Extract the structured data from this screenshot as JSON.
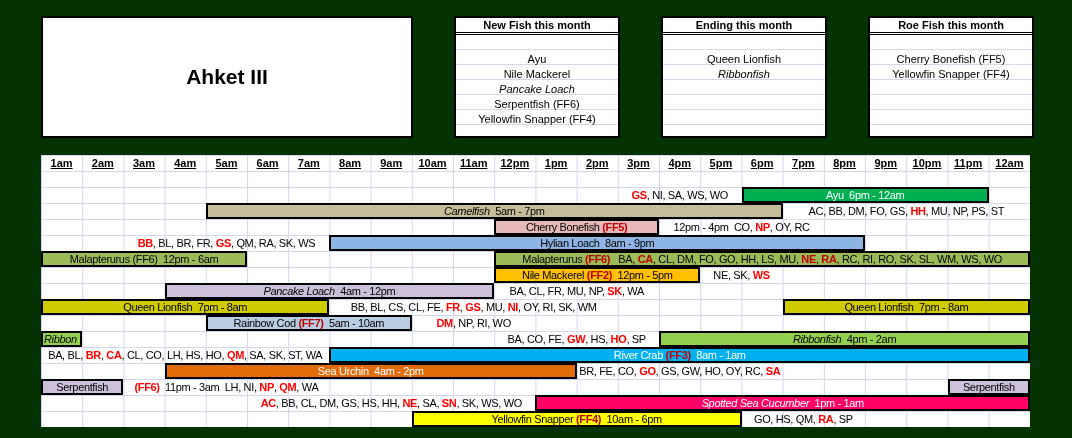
{
  "title": "Ahket III",
  "lists": [
    {
      "heading": "New Fish this month",
      "items": [
        {
          "text": "Ayu",
          "italic": false
        },
        {
          "text": "Nile Mackerel",
          "italic": false
        },
        {
          "text": "Pancake Loach",
          "italic": true
        },
        {
          "text": "Serpentfish (FF6)",
          "italic": false
        },
        {
          "text": "Yellowfin Snapper (FF4)",
          "italic": false
        }
      ]
    },
    {
      "heading": "Ending this month",
      "items": [
        {
          "text": "Queen Lionfish",
          "italic": false
        },
        {
          "text": "Ribbonfish",
          "italic": true
        }
      ]
    },
    {
      "heading": "Roe Fish this month",
      "items": [
        {
          "text": "Cherry Bonefish (FF5)",
          "italic": false
        },
        {
          "text": "Yellowfin Snapper (FF4)",
          "italic": false
        }
      ]
    }
  ],
  "hours": [
    "1am",
    "2am",
    "3am",
    "4am",
    "5am",
    "6am",
    "7am",
    "8am",
    "9am",
    "10am",
    "11am",
    "12pm",
    "1pm",
    "2pm",
    "3pm",
    "4pm",
    "5pm",
    "6pm",
    "7pm",
    "8pm",
    "9pm",
    "10pm",
    "11pm",
    "12am"
  ],
  "rows": [
    {
      "segments": [
        {
          "kind": "note",
          "text": "**GS**, NI, SA, WS, WO"
        },
        {
          "kind": "bar",
          "text": "Ayu  6pm - 12am",
          "color": "#00b050"
        }
      ]
    },
    {
      "segments": [
        {
          "kind": "bar",
          "text": "*Camelfish*  5am - 7pm",
          "color": "#c4bd97"
        },
        {
          "kind": "note",
          "text": "AC, BB, DM, FO, GS, **HH**, MU, NP, PS, ST"
        }
      ]
    },
    {
      "segments": [
        {
          "kind": "bar",
          "text": "Cherry Bonefish **(FF5)**",
          "color": "#e6b8b7"
        },
        {
          "kind": "note",
          "text": "12pm - 4pm  CO, **NP**, OY, RC"
        }
      ]
    },
    {
      "segments": [
        {
          "kind": "note",
          "text": "**BB**, BL, BR, FR, **GS**, QM, RA, SK, WS"
        },
        {
          "kind": "bar",
          "text": "Hylian Loach  8am - 9pm",
          "color": "#8db4e2"
        }
      ]
    },
    {
      "segments": [
        {
          "kind": "bar",
          "text": "Malapterurus (FF6)  12pm - 6am",
          "color": "#9bbb59"
        },
        {
          "kind": "bar",
          "text": "Malapterurus **(FF6)**   BA, **CA**, CL, DM, FO, GO, HH, LS, MU, **NE**, **RA**, RC, RI, RO, SK, SL, WM, WS, WO",
          "color": "#9bbb59"
        }
      ]
    },
    {
      "segments": [
        {
          "kind": "bar",
          "text": "Nile Mackerel **(FF2)**  12pm - 5pm",
          "color": "#ffc000"
        },
        {
          "kind": "note",
          "text": "NE, SK, **WS**"
        }
      ]
    },
    {
      "segments": [
        {
          "kind": "bar",
          "text": "*Pancake Loach*  4am - 12pm",
          "color": "#ccc0da"
        },
        {
          "kind": "note",
          "text": "BA, CL, FR, MU, NP, **SK**, WA"
        }
      ]
    },
    {
      "segments": [
        {
          "kind": "bar",
          "text": "Queen Lionfish  7pm - 8am",
          "color": "#d0cb00"
        },
        {
          "kind": "note",
          "text": "BB, BL, CS, CL, FE, **FR**, **GS**, MU, **NI**, OY, RI, SK, WM"
        },
        {
          "kind": "bar",
          "text": "Queen Lionfish  7pm - 8am",
          "color": "#d0cb00"
        }
      ]
    },
    {
      "segments": [
        {
          "kind": "bar",
          "text": "Rainbow Cod **(FF7)**  5am - 10am",
          "color": "#b8cce4"
        },
        {
          "kind": "note",
          "text": "**DM**, NP, RI, WO"
        }
      ]
    },
    {
      "segments": [
        {
          "kind": "bar",
          "text": "*Ribbon*",
          "color": "#92d050"
        },
        {
          "kind": "note",
          "text": "BA, CO, FE, **GW**, HS, **HO**, SP"
        },
        {
          "kind": "bar",
          "text": "*Ribbonfish*  4pm - 2am",
          "color": "#92d050"
        }
      ]
    },
    {
      "segments": [
        {
          "kind": "note",
          "text": "BA, BL, **BR**, **CA**, CL, CO, LH, HS, HO, **QM**, SA, SK, ST, WA"
        },
        {
          "kind": "bar",
          "text": "River Crab **(FF3)**  8am - 1am",
          "color": "#00b0f0"
        }
      ]
    },
    {
      "segments": [
        {
          "kind": "bar",
          "text": "Sea Urchin  4am - 2pm",
          "color": "#e26b0a"
        },
        {
          "kind": "note",
          "text": "BR, FE, CO, **GO**, GS, GW, HO, OY, RC, **SA**"
        }
      ]
    },
    {
      "segments": [
        {
          "kind": "bar",
          "text": "Serpentfish",
          "color": "#ccc0da"
        },
        {
          "kind": "note",
          "text": "**(FF6)**  11pm - 3am  LH, NI, **NP**, **QM**, WA"
        },
        {
          "kind": "bar",
          "text": "Serpentfish",
          "color": "#ccc0da"
        }
      ]
    },
    {
      "segments": [
        {
          "kind": "note",
          "text": "**AC**, BB, CL, DM, GS, HS, HH, **NE**, SA, **SN**, SK, WS, WO"
        },
        {
          "kind": "bar",
          "text": "*Spotted Sea Cucumber*  1pm - 1am",
          "color": "#ff0066"
        }
      ]
    },
    {
      "segments": [
        {
          "kind": "bar",
          "text": "Yellowfin Snapper **(FF4)**  10am - 6pm",
          "color": "#ffff00"
        },
        {
          "kind": "note",
          "text": "GO, HS, QM, **RA**, SP"
        }
      ]
    }
  ]
}
